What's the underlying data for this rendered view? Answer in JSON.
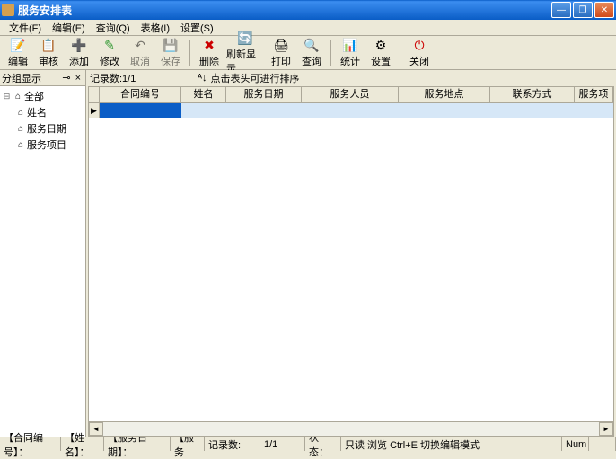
{
  "window": {
    "title": "服务安排表"
  },
  "menu": {
    "file": "文件(F)",
    "edit": "编辑(E)",
    "query": "查询(Q)",
    "table": "表格(I)",
    "settings": "设置(S)"
  },
  "toolbar": {
    "edit": "编辑",
    "review": "审核",
    "add": "添加",
    "modify": "修改",
    "cancel": "取消",
    "save": "保存",
    "delete": "删除",
    "refresh": "刷新显示",
    "print": "打印",
    "query": "查询",
    "stats": "统计",
    "settings": "设置",
    "close": "关闭"
  },
  "sidebar": {
    "title": "分组显示",
    "root": "全部",
    "items": [
      "姓名",
      "服务日期",
      "服务项目"
    ]
  },
  "grid": {
    "record_count": "记录数:1/1",
    "sort_hint": "点击表头可进行排序",
    "columns": [
      "合同编号",
      "姓名",
      "服务日期",
      "服务人员",
      "服务地点",
      "联系方式",
      "服务项"
    ]
  },
  "statusbar": {
    "f1": "【合同编号】：",
    "f2": "【姓名】：",
    "f3": "【服务日期】：",
    "f4": "【服务",
    "rec_lbl": "记录数:",
    "rec_val": "1/1",
    "state_lbl": "状态：",
    "mode": "只读 浏览 Ctrl+E 切换编辑模式",
    "num": "Num"
  }
}
